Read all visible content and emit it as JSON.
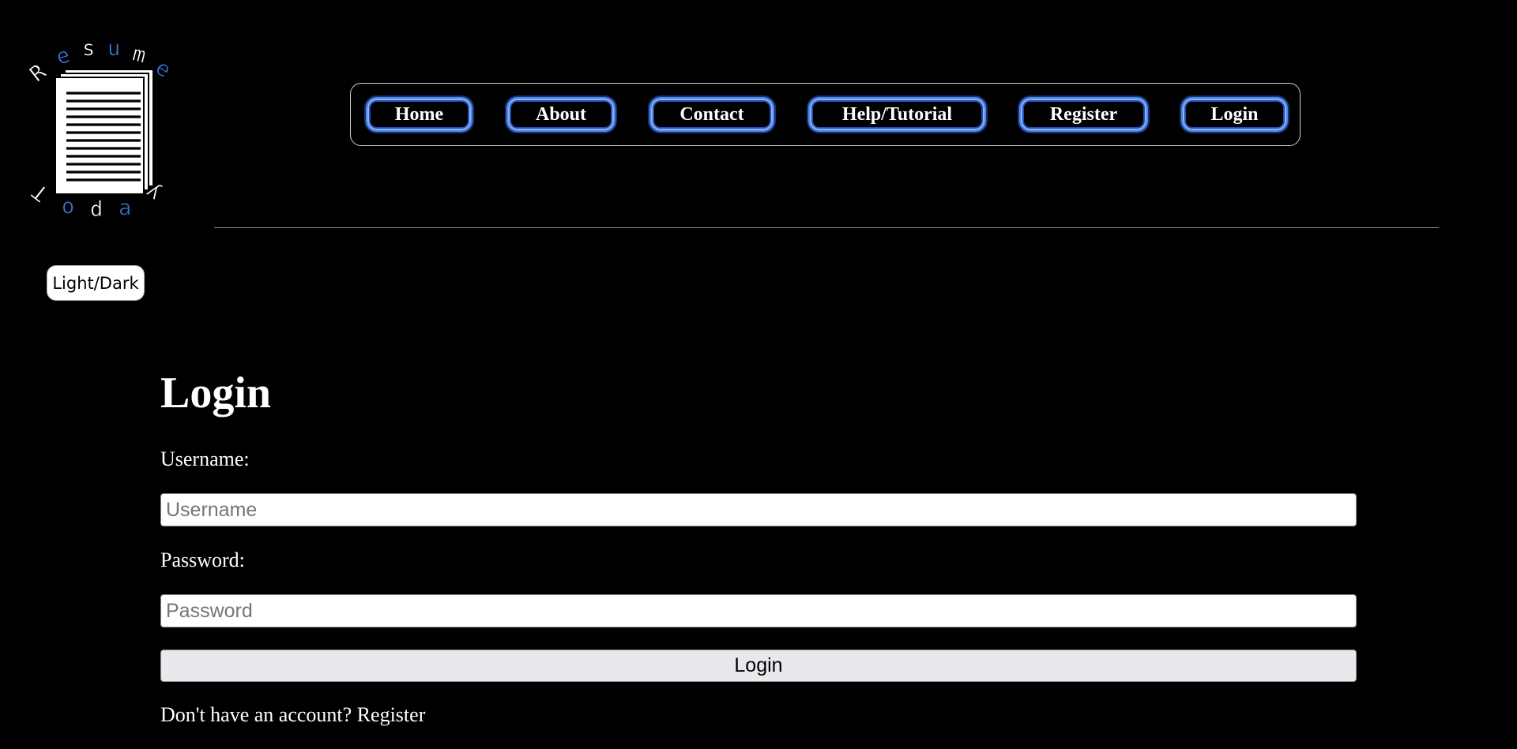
{
  "logo": {
    "top_word": "Resume",
    "bottom_word": "Today",
    "accent_color": "#3a74d8",
    "icon": "document-stack-icon"
  },
  "nav": {
    "items": [
      {
        "label": "Home"
      },
      {
        "label": "About"
      },
      {
        "label": "Contact"
      },
      {
        "label": "Help/Tutorial"
      },
      {
        "label": "Register"
      },
      {
        "label": "Login"
      }
    ],
    "accent_color": "#4f86e6"
  },
  "theme_toggle": {
    "label": "Light/Dark"
  },
  "form": {
    "title": "Login",
    "username_label": "Username:",
    "username_placeholder": "Username",
    "username_value": "",
    "password_label": "Password:",
    "password_placeholder": "Password",
    "password_value": "",
    "submit_label": "Login",
    "footer_text": "Don't have an account?",
    "footer_link": "Register"
  }
}
